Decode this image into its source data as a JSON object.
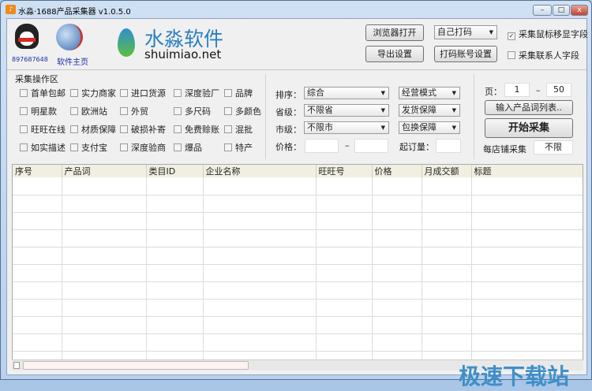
{
  "window": {
    "title": "水淼·1688产品采集器 v1.0.5.0",
    "minimize": "–",
    "maximize": "□",
    "close": "x"
  },
  "header": {
    "qq_number": "897687648",
    "homepage_label": "软件主页",
    "brand_cn": "水淼软件",
    "brand_url": "shuimiao.net"
  },
  "toolbar": {
    "open_browser": "浏览器打开",
    "export_settings": "导出设置",
    "captcha_mode": "自己打码",
    "captcha_account": "打码账号设置",
    "hover_fields": {
      "label": "采集鼠标移显字段",
      "checked": true
    },
    "contact_fields": {
      "label": "采集联系人字段",
      "checked": false
    }
  },
  "filters": {
    "group_title": "采集操作区",
    "checkboxes": [
      [
        "首单包邮",
        "实力商家",
        "进口货源",
        "深度验厂",
        "品牌"
      ],
      [
        "明星款",
        "欧洲站",
        "外贸",
        "多尺码",
        "多颜色"
      ],
      [
        "旺旺在线",
        "材质保障",
        "破损补寄",
        "免费赊账",
        "混批"
      ],
      [
        "如实描述",
        "支付宝",
        "深度验商",
        "爆品",
        "特产"
      ]
    ]
  },
  "options": {
    "sort_label": "排序：",
    "sort_value": "综合",
    "province_label": "省级：",
    "province_value": "不限省",
    "city_label": "市级：",
    "city_value": "不限市",
    "price_label": "价格：",
    "price_min": "",
    "price_max": "",
    "price_sep": "–",
    "business_mode": "经营模式",
    "shipping": "发货保障",
    "exchange": "包换保障",
    "moq_label": "起订量：",
    "moq_value": ""
  },
  "run": {
    "page_label": "页：",
    "page_from": "1",
    "page_sep": "–",
    "page_to": "50",
    "input_keywords": "输入产品词列表..",
    "start": "开始采集",
    "per_shop_label": "每店铺采集",
    "per_shop_value": "不限"
  },
  "table": {
    "columns": [
      "序号",
      "产品词",
      "类目ID",
      "企业名称",
      "旺旺号",
      "价格",
      "月成交额",
      "标题"
    ],
    "rows": []
  },
  "watermark": "极速下载站"
}
